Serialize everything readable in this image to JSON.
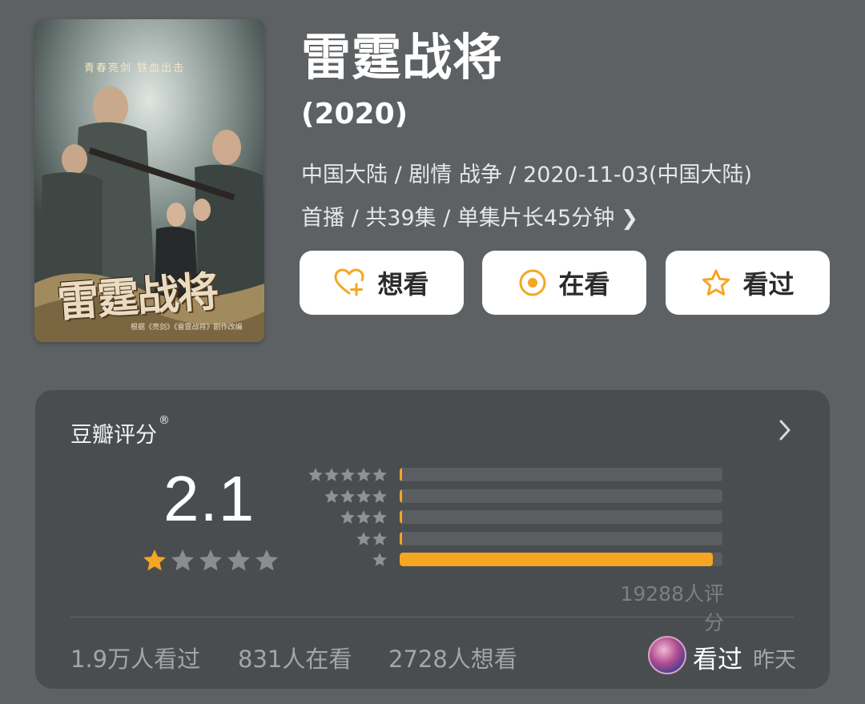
{
  "poster": {
    "title_text": "雷霆战将",
    "tagline": "青春亮剑 铁血出击",
    "subtitle": "根据《亮剑》《雷霆战将》剧作改编"
  },
  "title": "雷霆战将",
  "year": "(2020)",
  "meta": {
    "line1": "中国大陆 / 剧情 战争 / 2020-11-03(中国大陆)",
    "line2": "首播 / 共39集 / 单集片长45分钟"
  },
  "actions": {
    "want": "想看",
    "watching": "在看",
    "watched": "看过"
  },
  "rating": {
    "label": "豆瓣评分",
    "registered_mark": "®",
    "score": "2.1",
    "stars_filled": 1,
    "stars_total": 5,
    "distribution": [
      {
        "stars": 5,
        "fraction": 0.005
      },
      {
        "stars": 4,
        "fraction": 0.005
      },
      {
        "stars": 3,
        "fraction": 0.005
      },
      {
        "stars": 2,
        "fraction": 0.005
      },
      {
        "stars": 1,
        "fraction": 0.97
      }
    ],
    "count": "19288人评分"
  },
  "stats": {
    "watched": "1.9万人看过",
    "watching": "831人在看",
    "want": "2728人想看"
  },
  "user": {
    "status": "看过",
    "time": "昨天"
  },
  "colors": {
    "background": "#5e6163",
    "card": "#4a4d50",
    "accent": "#f5a623",
    "star_gray": "#8a8d90"
  }
}
